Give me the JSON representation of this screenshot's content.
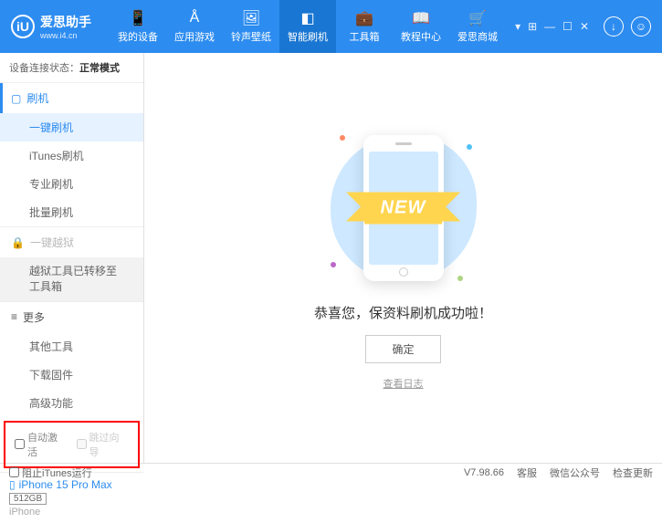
{
  "header": {
    "logo": {
      "title": "爱思助手",
      "url": "www.i4.cn",
      "mark": "iU"
    },
    "nav": [
      {
        "label": "我的设备"
      },
      {
        "label": "应用游戏"
      },
      {
        "label": "铃声壁纸"
      },
      {
        "label": "智能刷机"
      },
      {
        "label": "工具箱"
      },
      {
        "label": "教程中心"
      },
      {
        "label": "爱思商城"
      }
    ]
  },
  "sidebar": {
    "conn_label": "设备连接状态：",
    "conn_value": "正常模式",
    "flash_header": "刷机",
    "flash_items": [
      "一键刷机",
      "iTunes刷机",
      "专业刷机",
      "批量刷机"
    ],
    "jailbreak_header": "一键越狱",
    "jailbreak_moved": "越狱工具已转移至工具箱",
    "more_header": "更多",
    "more_items": [
      "其他工具",
      "下载固件",
      "高级功能"
    ],
    "checkboxes": {
      "auto_activate": "自动激活",
      "skip_guide": "跳过向导"
    },
    "device": {
      "name": "iPhone 15 Pro Max",
      "storage": "512GB",
      "type": "iPhone"
    }
  },
  "main": {
    "ribbon": "NEW",
    "success": "恭喜您，保资料刷机成功啦！",
    "ok": "确定",
    "log": "查看日志"
  },
  "footer": {
    "block_itunes": "阻止iTunes运行",
    "version": "V7.98.66",
    "links": [
      "客服",
      "微信公众号",
      "检查更新"
    ]
  }
}
